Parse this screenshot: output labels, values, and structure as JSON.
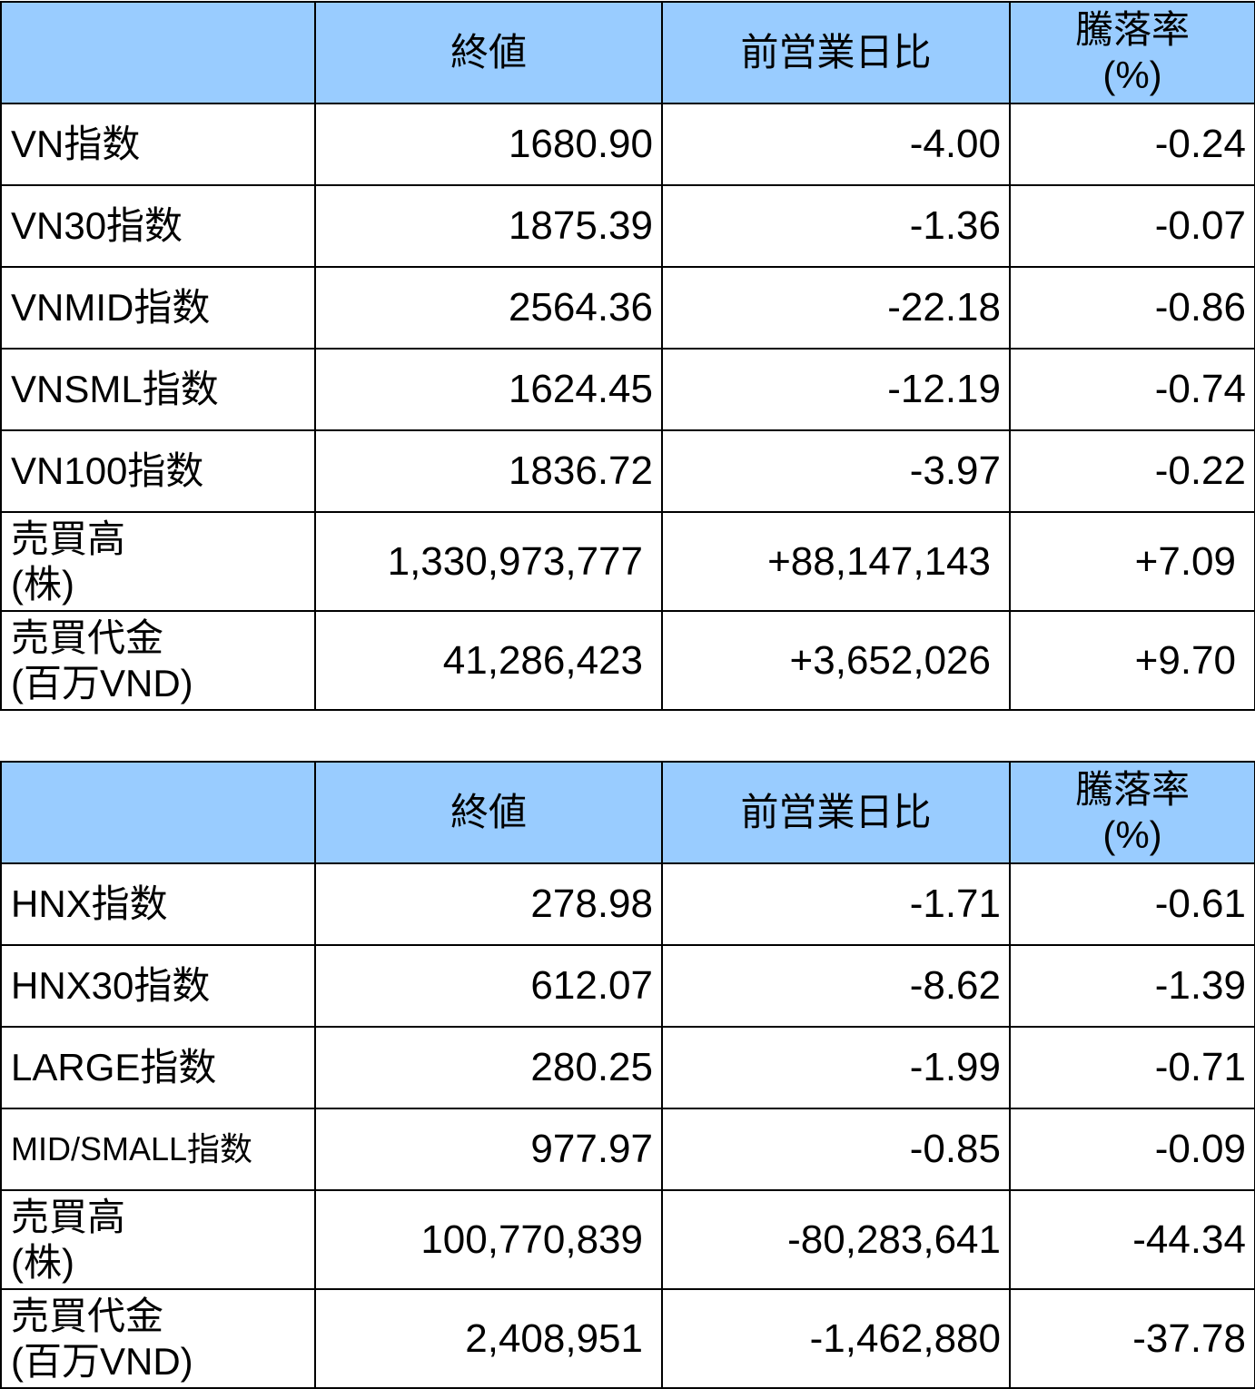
{
  "headers": {
    "name": "",
    "close": "終値",
    "change": "前営業日比",
    "pct_line1": "騰落率",
    "pct_line2": "(%)"
  },
  "hose": [
    {
      "name": "VN指数",
      "close": "1680.90",
      "change": "-4.00",
      "pct": "-0.24"
    },
    {
      "name": "VN30指数",
      "close": "1875.39",
      "change": "-1.36",
      "pct": "-0.07"
    },
    {
      "name": "VNMID指数",
      "close": "2564.36",
      "change": "-22.18",
      "pct": "-0.86"
    },
    {
      "name": "VNSML指数",
      "close": "1624.45",
      "change": "-12.19",
      "pct": "-0.74"
    },
    {
      "name": "VN100指数",
      "close": "1836.72",
      "change": "-3.97",
      "pct": "-0.22"
    },
    {
      "name1": "売買高",
      "name2": "(株)",
      "close": "1,330,973,777",
      "change": "+88,147,143",
      "pct": "+7.09"
    },
    {
      "name1": "売買代金",
      "name2": "(百万VND)",
      "close": "41,286,423",
      "change": "+3,652,026",
      "pct": "+9.70"
    }
  ],
  "hnx": [
    {
      "name": "HNX指数",
      "close": "278.98",
      "change": "-1.71",
      "pct": "-0.61"
    },
    {
      "name": "HNX30指数",
      "close": "612.07",
      "change": "-8.62",
      "pct": "-1.39"
    },
    {
      "name": "LARGE指数",
      "close": "280.25",
      "change": "-1.99",
      "pct": "-0.71"
    },
    {
      "name": "MID/SMALL指数",
      "close": "977.97",
      "change": "-0.85",
      "pct": "-0.09"
    },
    {
      "name1": "売買高",
      "name2": "(株)",
      "close": "100,770,839",
      "change": "-80,283,641",
      "pct": "-44.34"
    },
    {
      "name1": "売買代金",
      "name2": "(百万VND)",
      "close": "2,408,951",
      "change": "-1,462,880",
      "pct": "-37.78"
    }
  ],
  "colors": {
    "header_bg": "#99ccff",
    "border": "#000000",
    "text": "#000000"
  }
}
